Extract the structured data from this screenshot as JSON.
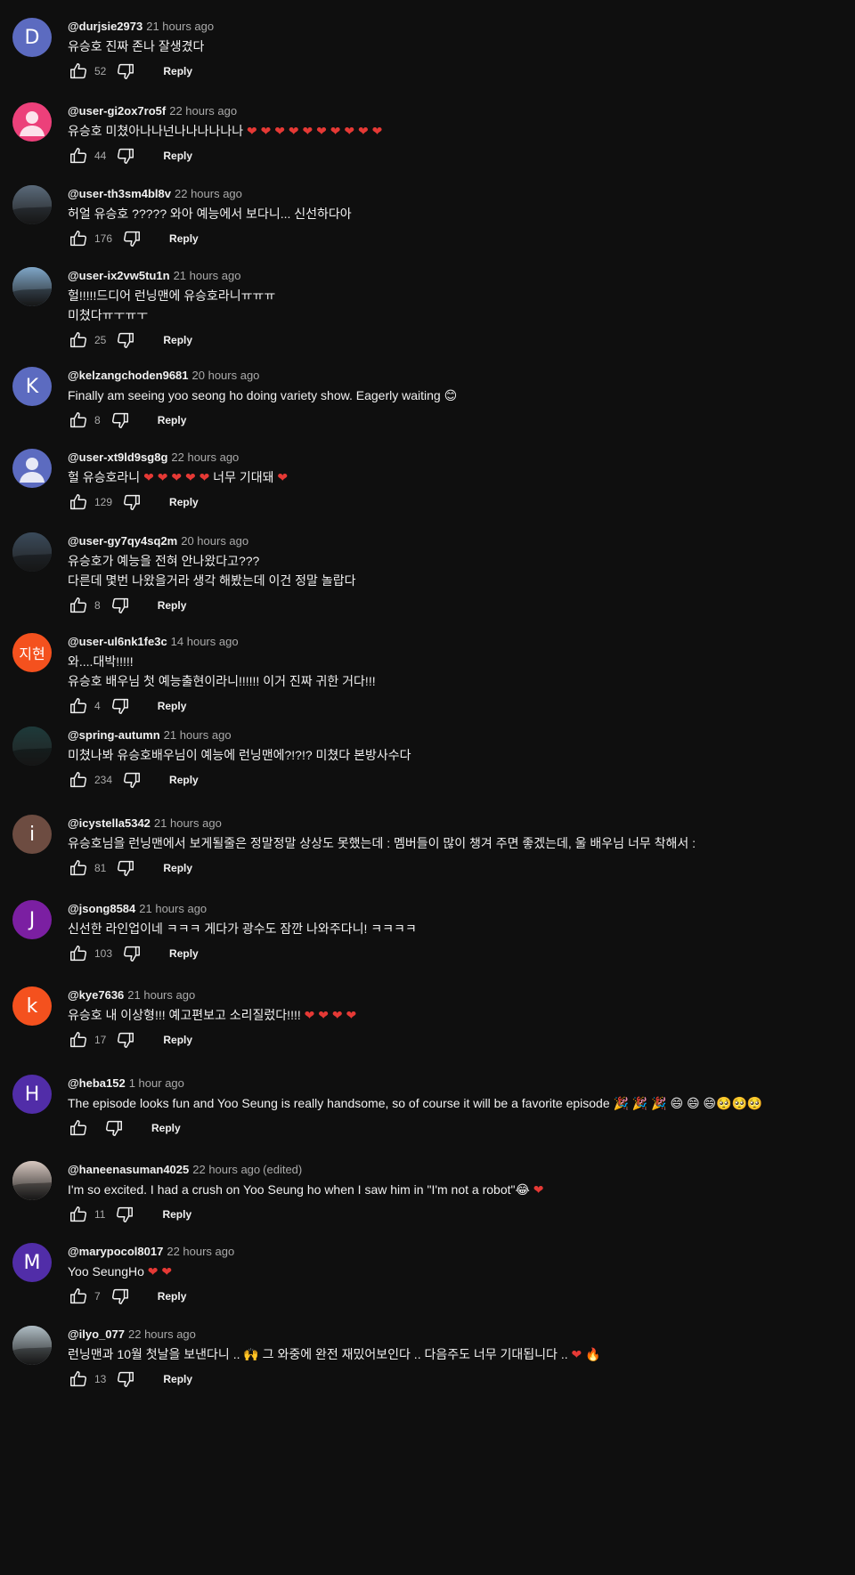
{
  "ui": {
    "reply_label": "Reply"
  },
  "comments": [
    {
      "author": "@durjsie2973",
      "time": "21 hours ago",
      "lines": [
        "유승호 진짜 존나 잘생겼다"
      ],
      "likes": "52",
      "avatar": {
        "type": "letter",
        "letter": "D",
        "color": "#5c6bc0"
      }
    },
    {
      "author": "@user-gi2ox7ro5f",
      "time": "22 hours ago",
      "lines": [
        "유승호 미쳤아나나넌나나나나나나 ❤️ ❤️ ❤️ ❤️ ❤️ ❤️ ❤️ ❤️ ❤️ ❤️"
      ],
      "likes": "44",
      "avatar": {
        "type": "person",
        "color": "#ec407a"
      }
    },
    {
      "author": "@user-th3sm4bl8v",
      "time": "22 hours ago",
      "lines": [
        "허얼 유승호 ?????  와아 예능에서 보다니... 신선하다아"
      ],
      "likes": "176",
      "avatar": {
        "type": "photo",
        "color": "#5a6a7a"
      }
    },
    {
      "author": "@user-ix2vw5tu1n",
      "time": "21 hours ago",
      "lines": [
        "헐!!!!!드디어 런닝맨에 유승호라니ㅠㅠㅠ",
        "미쳤다ㅠㅜㅠㅜ"
      ],
      "likes": "25",
      "avatar": {
        "type": "photo",
        "color": "#7fa6c8"
      }
    },
    {
      "author": "@kelzangchoden9681",
      "time": "20 hours ago",
      "lines": [
        "Finally am seeing yoo seong ho doing variety show. Eagerly waiting 😊"
      ],
      "likes": "8",
      "avatar": {
        "type": "letter",
        "letter": "K",
        "color": "#5c6bc0"
      }
    },
    {
      "author": "@user-xt9ld9sg8g",
      "time": "22 hours ago",
      "lines": [
        "헐 유승호라니 ❤️ ❤️ ❤️ ❤️ ❤️  너무 기대돼 ❤️"
      ],
      "likes": "129",
      "avatar": {
        "type": "person",
        "color": "#5c6bc0"
      }
    },
    {
      "author": "@user-gy7qy4sq2m",
      "time": "20 hours ago",
      "lines": [
        "유승호가 예능을 전혀 안나왔다고???",
        "다른데 몇번 나왔을거라 생각 해봤는데 이건 정말 놀랍다"
      ],
      "likes": "8",
      "avatar": {
        "type": "photo",
        "color": "#3a4a5a"
      }
    },
    {
      "author": "@user-ul6nk1fe3c",
      "time": "14 hours ago",
      "lines": [
        "와....대박!!!!!",
        "유승호 배우님 첫 예능출현이라니!!!!!! 이거 진짜 귀한 거다!!!"
      ],
      "likes": "4",
      "avatar": {
        "type": "letter",
        "letter": "지현",
        "color": "#f4511e"
      }
    },
    {
      "author": "@spring-autumn",
      "time": "21 hours ago",
      "lines": [
        "미쳤나봐 유승호배우님이 예능에 런닝맨에?!?!? 미쳤다 본방사수다"
      ],
      "likes": "234",
      "avatar": {
        "type": "photo",
        "color": "#1e3a3a"
      }
    },
    {
      "author": "@icystella5342",
      "time": "21 hours ago",
      "lines": [
        "유승호님을 런닝맨에서 보게될줄은 정말정말 상상도 못했는데 : 멤버들이 많이 챙겨 주면 좋겠는데, 울 배우님 너무 착해서  :"
      ],
      "likes": "81",
      "avatar": {
        "type": "letter",
        "letter": "i",
        "color": "#6d4c41"
      }
    },
    {
      "author": "@jsong8584",
      "time": "21 hours ago",
      "lines": [
        "신선한 라인업이네 ㅋㅋㅋ 게다가 광수도 잠깐 나와주다니! ㅋㅋㅋㅋ"
      ],
      "likes": "103",
      "avatar": {
        "type": "letter",
        "letter": "J",
        "color": "#7b1fa2"
      }
    },
    {
      "author": "@kye7636",
      "time": "21 hours ago",
      "lines": [
        "유승호 내 이상형!!! 예고편보고 소리질렀다!!!! ❤️ ❤️ ❤️ ❤️"
      ],
      "likes": "17",
      "avatar": {
        "type": "letter",
        "letter": "k",
        "color": "#f4511e"
      }
    },
    {
      "author": "@heba152",
      "time": "1 hour ago",
      "lines": [
        "The episode looks fun and Yoo Seung is really handsome, so of course it will be a favorite episode 🎉 🎉 🎉 😄 😄 😄🥺🥺🥺"
      ],
      "likes": "",
      "avatar": {
        "type": "letter",
        "letter": "H",
        "color": "#512da8"
      }
    },
    {
      "author": "@haneenasuman4025",
      "time": "22 hours ago",
      "edited": "(edited)",
      "lines": [
        "I'm so excited. I had a crush on Yoo Seung ho when I saw him in \"I'm not a robot\"😂 ❤️"
      ],
      "likes": "11",
      "avatar": {
        "type": "photo",
        "color": "#d8c8c0"
      }
    },
    {
      "author": "@marypocol8017",
      "time": "22 hours ago",
      "lines": [
        "Yoo SeungHo ❤️ ❤️"
      ],
      "likes": "7",
      "avatar": {
        "type": "letter",
        "letter": "M",
        "color": "#512da8"
      }
    },
    {
      "author": "@ilyo_077",
      "time": "22 hours ago",
      "lines": [
        "런닝맨과 10월 첫날을 보낸다니 .. 🙌 그 와중에 완전 재밌어보인다 .. 다음주도 너무 기대됩니다 .. ❤️ 🔥"
      ],
      "likes": "13",
      "avatar": {
        "type": "photo",
        "color": "#b0bec5"
      }
    }
  ]
}
